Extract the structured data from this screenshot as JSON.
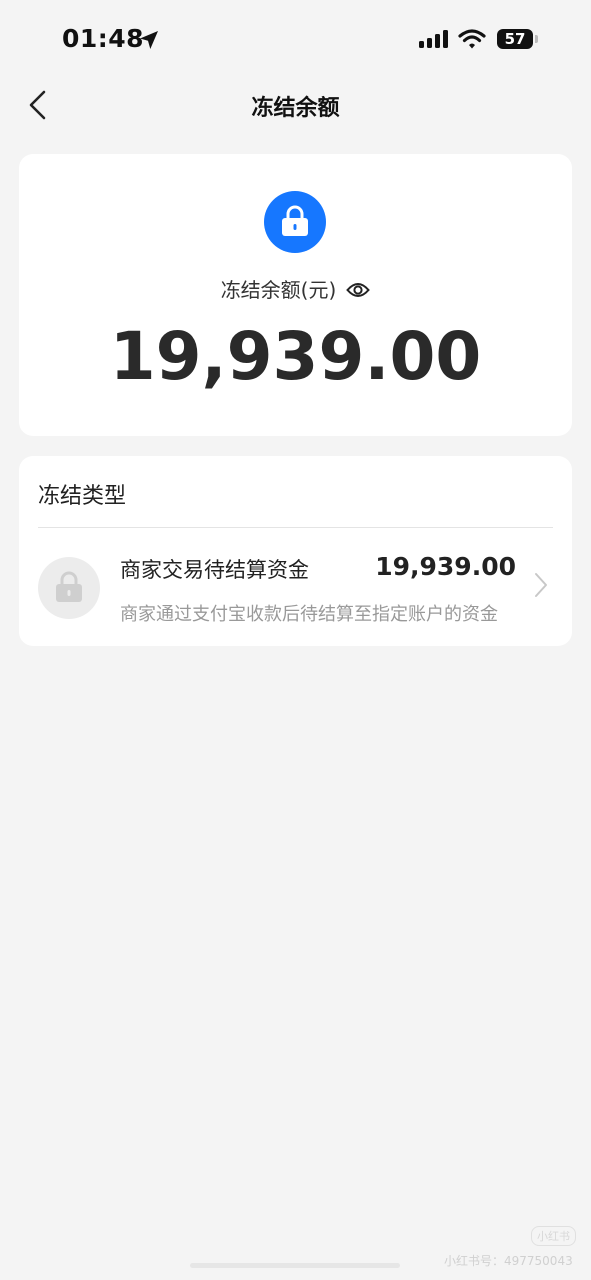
{
  "status_bar": {
    "time": "01:48",
    "battery": "57"
  },
  "nav": {
    "title": "冻结余额"
  },
  "balance": {
    "label": "冻结余额(元)",
    "amount": "19,939.00"
  },
  "freeze_types": {
    "header": "冻结类型",
    "items": [
      {
        "title": "商家交易待结算资金",
        "amount": "19,939.00",
        "description": "商家通过支付宝收款后待结算至指定账户的资金"
      }
    ]
  },
  "watermark": {
    "badge": "小红书",
    "text": "小红书号：497750043"
  },
  "colors": {
    "accent": "#1677ff",
    "background": "#f4f4f4"
  },
  "icons": {
    "location": "location-arrow-icon",
    "signal": "cellular-signal-icon",
    "wifi": "wifi-icon",
    "back": "chevron-left-icon",
    "lock": "lock-icon",
    "eye": "eye-icon",
    "chevron": "chevron-right-icon"
  }
}
